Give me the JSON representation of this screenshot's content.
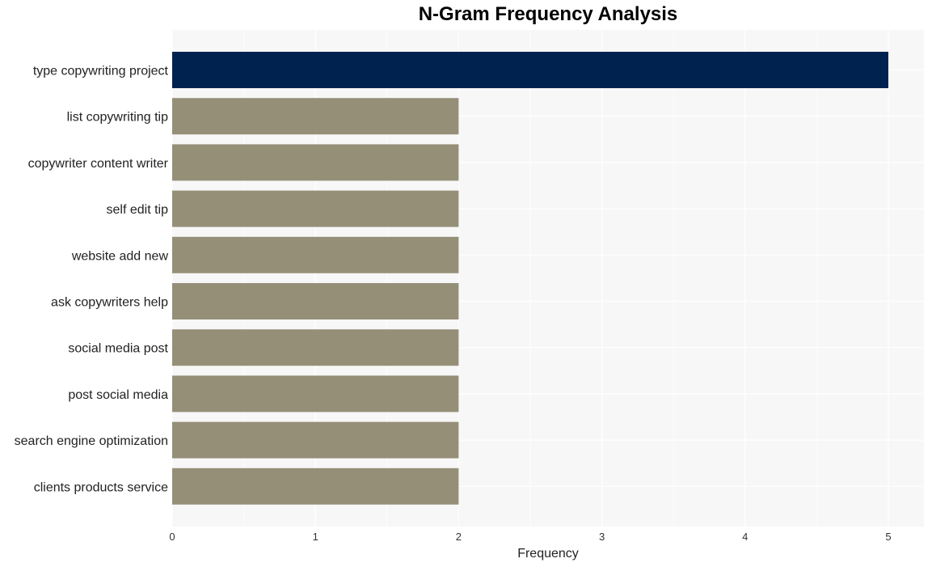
{
  "chart_data": {
    "type": "bar",
    "orientation": "horizontal",
    "title": "N-Gram Frequency Analysis",
    "xlabel": "Frequency",
    "ylabel": "",
    "xlim": [
      0,
      5.25
    ],
    "xticks": [
      0,
      1,
      2,
      3,
      4,
      5
    ],
    "grid": true,
    "categories": [
      "type copywriting project",
      "list copywriting tip",
      "copywriter content writer",
      "self edit tip",
      "website add new",
      "ask copywriters help",
      "social media post",
      "post social media",
      "search engine optimization",
      "clients products service"
    ],
    "values": [
      5,
      2,
      2,
      2,
      2,
      2,
      2,
      2,
      2,
      2
    ],
    "colors": {
      "highlight": "#00224e",
      "default": "#958f78",
      "panel_background": "#f7f7f7",
      "gridline": "#ffffff"
    }
  }
}
